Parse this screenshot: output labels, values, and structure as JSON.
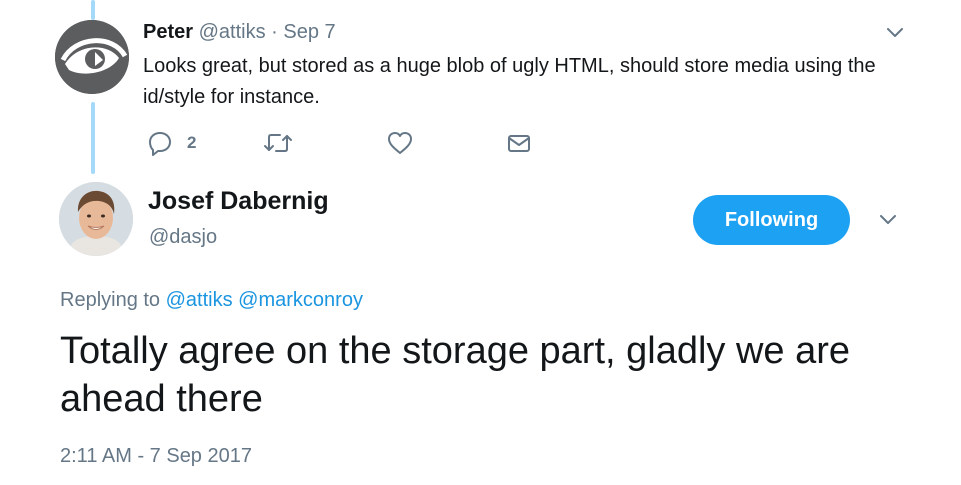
{
  "parent_tweet": {
    "name": "Peter",
    "handle": "@attiks",
    "separator": "·",
    "date": "Sep 7",
    "text": "Looks great, but stored as a huge blob of ugly HTML, should store media using the id/style for instance.",
    "reply_count": "2",
    "icons": [
      "reply-icon",
      "retweet-icon",
      "like-icon",
      "direct-message-icon",
      "chevron-down-icon"
    ]
  },
  "main_tweet": {
    "name": "Josef Dabernig",
    "handle": "@dasjo",
    "follow_label": "Following",
    "replying_prefix": "Replying to",
    "mentions": [
      "@attiks",
      "@markconroy"
    ],
    "text": "Totally agree on the storage part, gladly we are ahead there",
    "timestamp": "2:11 AM - 7 Sep 2017"
  },
  "colors": {
    "accent": "#1da1f2",
    "link": "#1b95e0",
    "muted_text": "#657786",
    "thread_line": "#a4d9f9"
  }
}
